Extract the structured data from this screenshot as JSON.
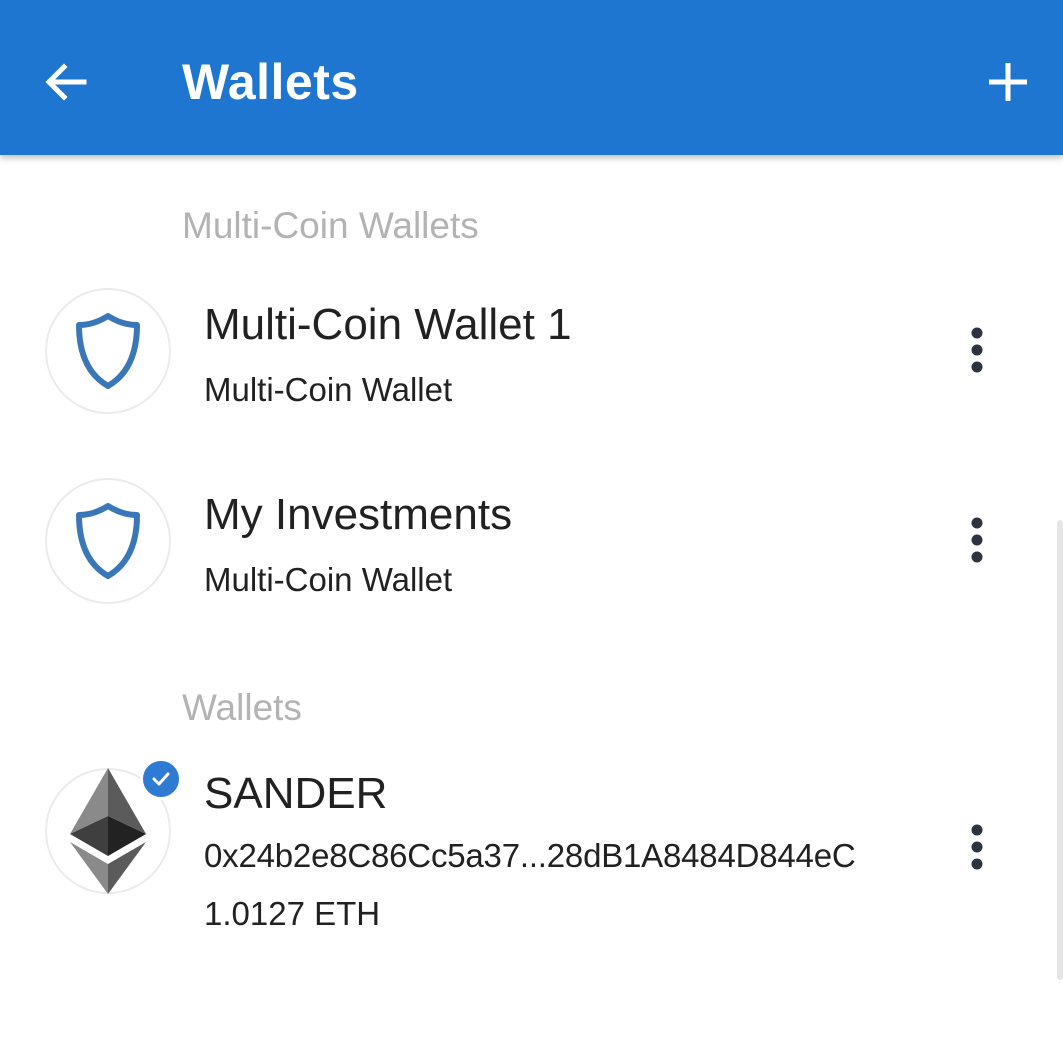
{
  "appbar": {
    "title": "Wallets",
    "back_icon": "arrow-left-icon",
    "add_icon": "plus-icon",
    "color": "#1e76d0"
  },
  "sections": {
    "multi_coin_header": "Multi-Coin Wallets",
    "wallets_header": "Wallets"
  },
  "multi_coin_wallets": [
    {
      "name": "Multi-Coin Wallet 1",
      "type": "Multi-Coin Wallet",
      "icon": "shield-icon"
    },
    {
      "name": "My Investments",
      "type": "Multi-Coin Wallet",
      "icon": "shield-icon"
    }
  ],
  "wallets": [
    {
      "name": "SANDER",
      "address": "0x24b2e8C86Cc5a37...28dB1A8484D844eC",
      "balance": "1.0127 ETH",
      "icon": "ethereum-icon",
      "selected": true
    }
  ],
  "colors": {
    "accent": "#1e76d0",
    "shield": "#3a77b8",
    "section_header": "#b3b3b3",
    "text": "#212121"
  }
}
